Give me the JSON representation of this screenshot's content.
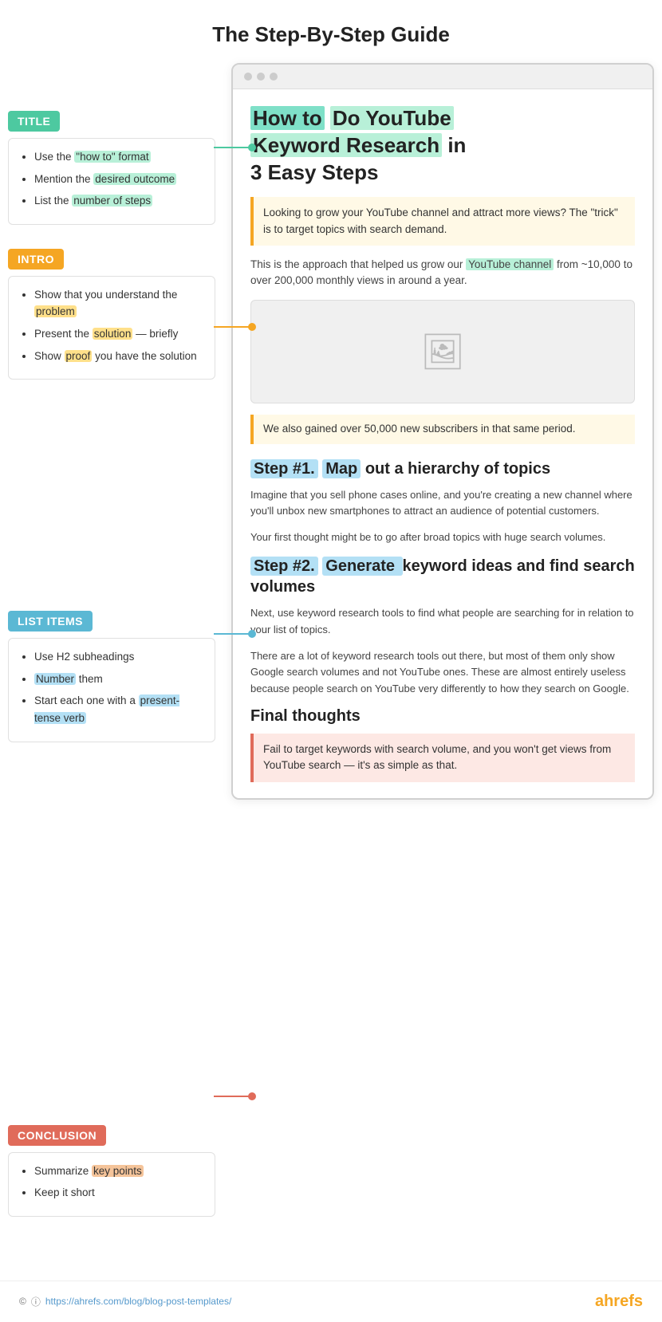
{
  "page": {
    "title": "The Step-By-Step Guide"
  },
  "sections": {
    "title_label": "TITLE",
    "title_items": [
      {
        "text": "Use the ",
        "highlight": "\"how to\" format",
        "highlight_class": "highlight-green",
        "rest": ""
      },
      {
        "text": "Mention the ",
        "highlight": "desired outcome",
        "highlight_class": "highlight-green",
        "rest": ""
      },
      {
        "text": "List the ",
        "highlight": "number of steps",
        "highlight_class": "highlight-green",
        "rest": ""
      }
    ],
    "intro_label": "INTRO",
    "intro_items": [
      {
        "text": "Show that you understand the ",
        "highlight": "problem",
        "highlight_class": "highlight-yellow",
        "rest": ""
      },
      {
        "text": "Present the ",
        "highlight": "solution",
        "highlight_class": "highlight-yellow",
        "rest": " — briefly"
      },
      {
        "text": "Show ",
        "highlight": "proof",
        "highlight_class": "highlight-yellow",
        "rest": " you have the solution"
      }
    ],
    "list_label": "LIST ITEMS",
    "list_items": [
      {
        "text": "Use H2 subheadings",
        "highlight": "",
        "highlight_class": "",
        "rest": ""
      },
      {
        "text": "",
        "highlight": "Number",
        "highlight_class": "highlight-blue",
        "rest": " them"
      },
      {
        "text": "Start each one with a ",
        "highlight": "present-tense verb",
        "highlight_class": "highlight-blue",
        "rest": ""
      }
    ],
    "conclusion_label": "CONCLUSION",
    "conclusion_items": [
      {
        "text": "Summarize ",
        "highlight": "key points",
        "highlight_class": "highlight-orange",
        "rest": ""
      },
      {
        "text": "Keep it short",
        "highlight": "",
        "highlight_class": "",
        "rest": ""
      }
    ]
  },
  "browser": {
    "article_title_part1": "How to",
    "article_title_part2": "Do YouTube",
    "article_title_part3": "Keyword Research",
    "article_title_part4": "in",
    "article_title_part5": "3 Easy Steps",
    "intro_box_text": "Looking to grow your YouTube channel and attract more views?  The \"trick\" is to target topics with search demand.",
    "intro_paragraph": "This is the approach that helped us grow our YouTube channel from ~10,000 to over 200,000 monthly views in around a year.",
    "caption_text": "We also gained over 50,000 new subscribers in that same period.",
    "step1_label": "Step #1.",
    "step1_title": " Map  out a hierarchy of topics",
    "step1_p1": "Imagine that you sell phone cases online, and you're creating a new channel where you'll unbox new smartphones to attract an audience of potential customers.",
    "step1_p2": "Your first thought might be to go after broad topics with huge search volumes.",
    "step2_label": "Step #2.",
    "step2_title": "  Generate  keyword ideas and find search volumes",
    "step2_p1": "Next, use keyword research tools to find what people are searching for in relation to your list of topics.",
    "step2_p2": "There are a lot of keyword research tools out there, but most of them only show Google search volumes and not YouTube ones. These are almost entirely useless because people search on YouTube very differently to how they search on Google.",
    "final_heading": "Final thoughts",
    "conclusion_text": "Fail to target keywords with search volume, and you won't get views from YouTube search — it's as simple as that."
  },
  "footer": {
    "url": "https://ahrefs.com/blog/blog-post-templates/",
    "logo": "ahrefs"
  }
}
